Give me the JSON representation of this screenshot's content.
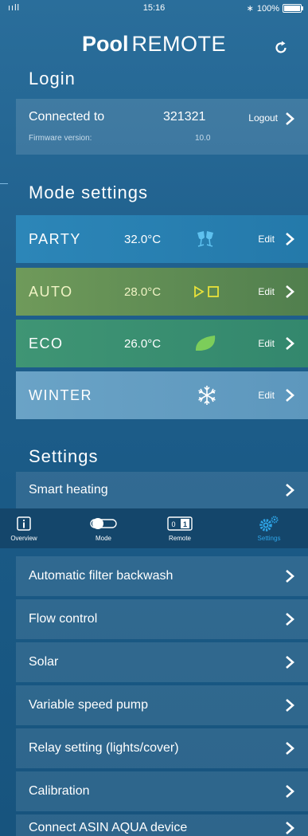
{
  "status": {
    "signal": "ııll",
    "time": "15:16",
    "bt": "∗",
    "battery": "100%"
  },
  "header": {
    "title_bold": "Pool",
    "title_thin": "REMOTE"
  },
  "login": {
    "heading": "Login",
    "connected_label": "Connected to",
    "device_id": "321321",
    "logout_label": "Logout",
    "firmware_label": "Firmware version:",
    "firmware_value": "10.0"
  },
  "modes": {
    "heading": "Mode settings",
    "edit_label": "Edit",
    "items": [
      {
        "name": "PARTY",
        "temp": "32.0°C",
        "icon": "party-glasses-icon"
      },
      {
        "name": "AUTO",
        "temp": "28.0°C",
        "icon": "auto-play-icon"
      },
      {
        "name": "ECO",
        "temp": "26.0°C",
        "icon": "leaf-icon"
      },
      {
        "name": "WINTER",
        "temp": "",
        "icon": "snowflake-icon"
      }
    ]
  },
  "settings": {
    "heading": "Settings",
    "items": [
      "Smart heating",
      "Automatic filter backwash",
      "Flow control",
      "Solar",
      "Variable speed pump",
      "Relay setting (lights/cover)",
      "Calibration",
      "Connect ASIN AQUA device"
    ]
  },
  "tabbar": {
    "tabs": [
      {
        "label": "Overview",
        "icon": "info-icon"
      },
      {
        "label": "Mode",
        "icon": "toggle-icon"
      },
      {
        "label": "Remote",
        "icon": "switch-icon",
        "left": "0",
        "right": "1"
      },
      {
        "label": "Settings",
        "icon": "gears-icon",
        "active": true
      }
    ]
  },
  "colors": {
    "background": "#1f5f8c",
    "accent": "#2ea5e8",
    "party": "#2c86b8",
    "auto": "#6f9a5a",
    "eco": "#3f9574",
    "winter": "#6aa3c6"
  }
}
